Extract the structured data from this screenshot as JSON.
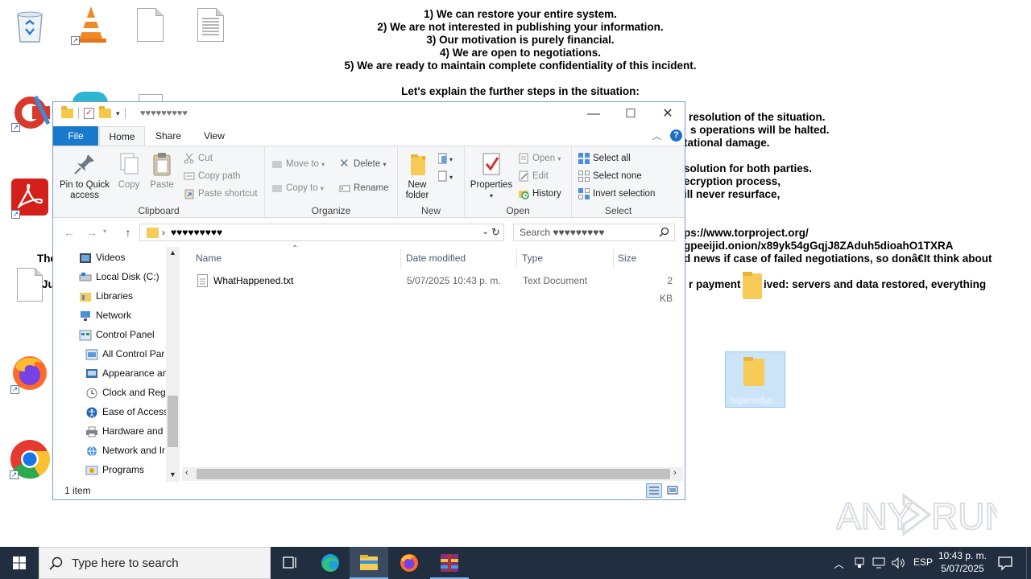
{
  "wallpaper": {
    "center_lines": [
      "1) We can restore your entire system.",
      "2) We are not interested in publishing your information.",
      "3) Our motivation is purely financial.",
      "4) We are open to negotiations.",
      "5) We are ready to maintain complete confidentiality of this incident.",
      "",
      "Let's explain the further steps in the situation:"
    ],
    "right_lines": [
      "resolution of the situation.",
      "s operations will be halted.",
      "tational damage.",
      "solution for both parties.",
      "ecryption process,",
      "ill never resurface,",
      "ps://www.torproject.org/",
      "gpeeijid.onion/x89yk54gGqjJ8ZAduh5dioahO1TXRA",
      "d news if case of failed negotiations, so donâ€It think about",
      "r payment",
      "ived: servers and data restored, everything"
    ],
    "left_fragments": [
      "The",
      "Ju"
    ],
    "watermark": "ANY RUN"
  },
  "desktop": {
    "selected_folder_label": "hapenedyp...",
    "icons": [
      "recycle-bin-icon",
      "vlc-icon",
      "blank-document-icon",
      "text-document-icon",
      "ccleaner-icon",
      "edge-icon",
      "acrobat-icon",
      "firefox-icon",
      "chrome-icon"
    ]
  },
  "window": {
    "title": "♥♥♥♥♥♥♥♥♥",
    "controls": {
      "minimize": "—",
      "maximize": "☐",
      "close": "✕"
    },
    "tabs": [
      "File",
      "Home",
      "Share",
      "View"
    ],
    "ribbon": {
      "clipboard": {
        "label": "Clipboard",
        "pin": "Pin to Quick access",
        "copy": "Copy",
        "paste": "Paste",
        "cut": "Cut",
        "copy_path": "Copy path",
        "paste_shortcut": "Paste shortcut"
      },
      "organize": {
        "label": "Organize",
        "move_to": "Move to",
        "copy_to": "Copy to",
        "delete": "Delete",
        "rename": "Rename"
      },
      "new": {
        "label": "New",
        "new_folder": "New folder"
      },
      "open": {
        "label": "Open",
        "properties": "Properties",
        "open": "Open",
        "edit": "Edit",
        "history": "History"
      },
      "select": {
        "label": "Select",
        "select_all": "Select all",
        "select_none": "Select none",
        "invert": "Invert selection"
      }
    },
    "address": {
      "path": "♥♥♥♥♥♥♥♥♥",
      "search_placeholder": "Search ♥♥♥♥♥♥♥♥♥"
    },
    "nav_items": [
      "Videos",
      "Local Disk (C:)",
      "Libraries",
      "Network",
      "Control Panel",
      "All Control Par",
      "Appearance an",
      "Clock and Regi",
      "Ease of Access",
      "Hardware and",
      "Network and Ir",
      "Programs"
    ],
    "columns": {
      "name": "Name",
      "date": "Date modified",
      "type": "Type",
      "size": "Size"
    },
    "files": [
      {
        "name": "WhatHappened.txt",
        "date": "5/07/2025 10:43 p. m.",
        "type": "Text Document",
        "size": "2 KB"
      }
    ],
    "status": "1 item"
  },
  "taskbar": {
    "search_placeholder": "Type here to search",
    "language": "ESP",
    "time": "10:43 p. m.",
    "date": "5/07/2025"
  }
}
